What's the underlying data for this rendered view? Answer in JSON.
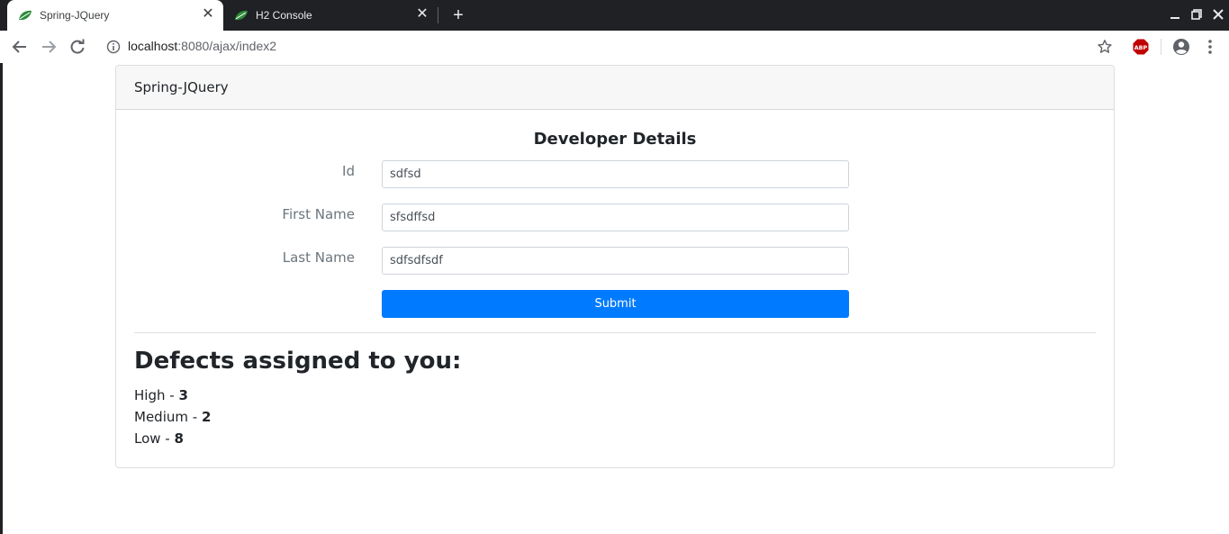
{
  "browser": {
    "tabs": [
      {
        "title": "Spring-JQuery",
        "active": true,
        "favicon": "spring-leaf-icon"
      },
      {
        "title": "H2 Console",
        "active": false,
        "favicon": "spring-leaf-icon"
      }
    ],
    "url_host": "localhost",
    "url_rest": ":8080/ajax/index2"
  },
  "colors": {
    "primary": "#007bff",
    "spring_green": "#2e8b3a",
    "abp_red": "#c00000"
  },
  "page": {
    "header_title": "Spring-JQuery",
    "form": {
      "title": "Developer Details",
      "fields": [
        {
          "label": "Id",
          "value": "sdfsd"
        },
        {
          "label": "First Name",
          "value": "sfsdffsd"
        },
        {
          "label": "Last Name",
          "value": "sdfsdfsdf"
        }
      ],
      "submit_label": "Submit"
    },
    "defects": {
      "heading": "Defects assigned to you:",
      "items": [
        {
          "label": "High - ",
          "count": "3"
        },
        {
          "label": "Medium - ",
          "count": "2"
        },
        {
          "label": "Low - ",
          "count": "8"
        }
      ]
    }
  }
}
